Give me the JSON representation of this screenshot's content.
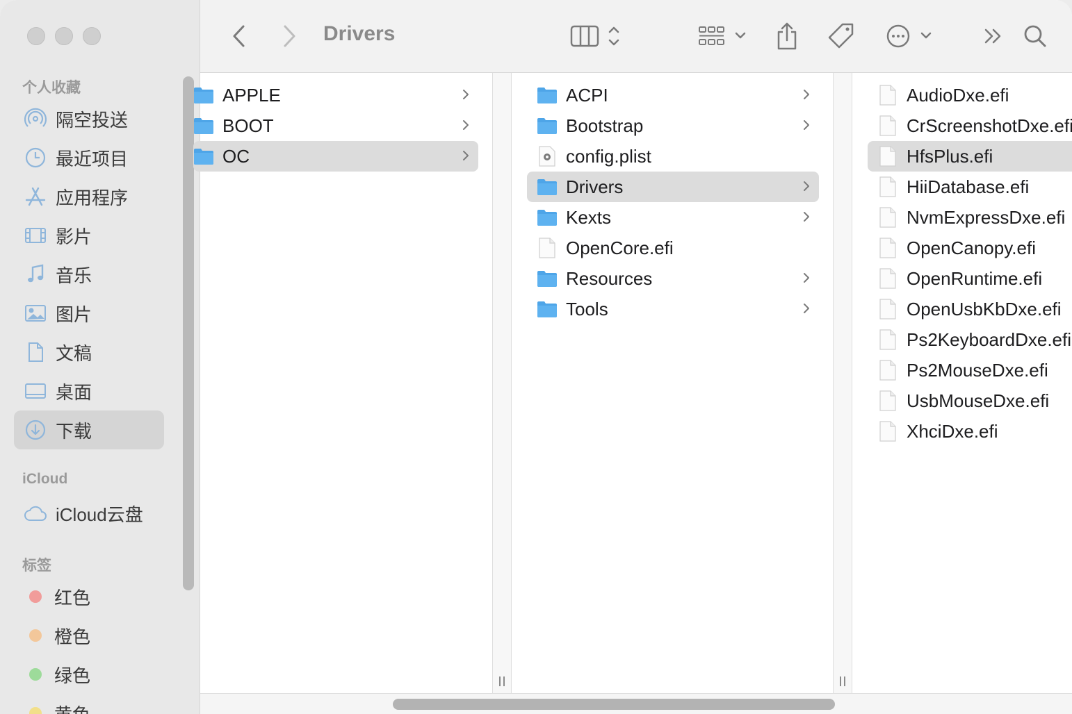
{
  "window": {
    "title": "Drivers"
  },
  "sidebar": {
    "favorites_title": "个人收藏",
    "favorites": [
      {
        "label": "隔空投送",
        "icon": "airdrop-icon"
      },
      {
        "label": "最近项目",
        "icon": "clock-icon"
      },
      {
        "label": "应用程序",
        "icon": "applications-icon"
      },
      {
        "label": "影片",
        "icon": "film-icon"
      },
      {
        "label": "音乐",
        "icon": "music-note-icon"
      },
      {
        "label": "图片",
        "icon": "photo-icon"
      },
      {
        "label": "文稿",
        "icon": "document-icon"
      },
      {
        "label": "桌面",
        "icon": "desktop-icon"
      },
      {
        "label": "下载",
        "icon": "download-icon",
        "selected": true
      }
    ],
    "icloud_title": "iCloud",
    "icloud": [
      {
        "label": "iCloud云盘",
        "icon": "cloud-icon"
      }
    ],
    "tags_title": "标签",
    "tags": [
      {
        "label": "红色",
        "color": "#f19c9a"
      },
      {
        "label": "橙色",
        "color": "#f3c79a"
      },
      {
        "label": "绿色",
        "color": "#9ddb9a"
      },
      {
        "label": "黄色",
        "color": "#f2df8a"
      }
    ]
  },
  "columns": [
    {
      "items": [
        {
          "label": "APPLE",
          "type": "folder",
          "has_children": true
        },
        {
          "label": "BOOT",
          "type": "folder",
          "has_children": true
        },
        {
          "label": "OC",
          "type": "folder",
          "has_children": true,
          "selected": true
        }
      ]
    },
    {
      "items": [
        {
          "label": "ACPI",
          "type": "folder",
          "has_children": true
        },
        {
          "label": "Bootstrap",
          "type": "folder",
          "has_children": true
        },
        {
          "label": "config.plist",
          "type": "plist",
          "has_children": false
        },
        {
          "label": "Drivers",
          "type": "folder",
          "has_children": true,
          "selected": true
        },
        {
          "label": "Kexts",
          "type": "folder",
          "has_children": true
        },
        {
          "label": "OpenCore.efi",
          "type": "file",
          "has_children": false
        },
        {
          "label": "Resources",
          "type": "folder",
          "has_children": true
        },
        {
          "label": "Tools",
          "type": "folder",
          "has_children": true
        }
      ]
    },
    {
      "items": [
        {
          "label": "AudioDxe.efi",
          "type": "file"
        },
        {
          "label": "CrScreenshotDxe.efi",
          "type": "file"
        },
        {
          "label": "HfsPlus.efi",
          "type": "file",
          "selected": true
        },
        {
          "label": "HiiDatabase.efi",
          "type": "file"
        },
        {
          "label": "NvmExpressDxe.efi",
          "type": "file"
        },
        {
          "label": "OpenCanopy.efi",
          "type": "file"
        },
        {
          "label": "OpenRuntime.efi",
          "type": "file"
        },
        {
          "label": "OpenUsbKbDxe.efi",
          "type": "file"
        },
        {
          "label": "Ps2KeyboardDxe.efi",
          "type": "file"
        },
        {
          "label": "Ps2MouseDxe.efi",
          "type": "file"
        },
        {
          "label": "UsbMouseDxe.efi",
          "type": "file"
        },
        {
          "label": "XhciDxe.efi",
          "type": "file"
        }
      ]
    }
  ],
  "colors": {
    "folder": "#5eb2f0",
    "accent_icon": "#8fb6db",
    "selection": "#dcdcdc"
  }
}
